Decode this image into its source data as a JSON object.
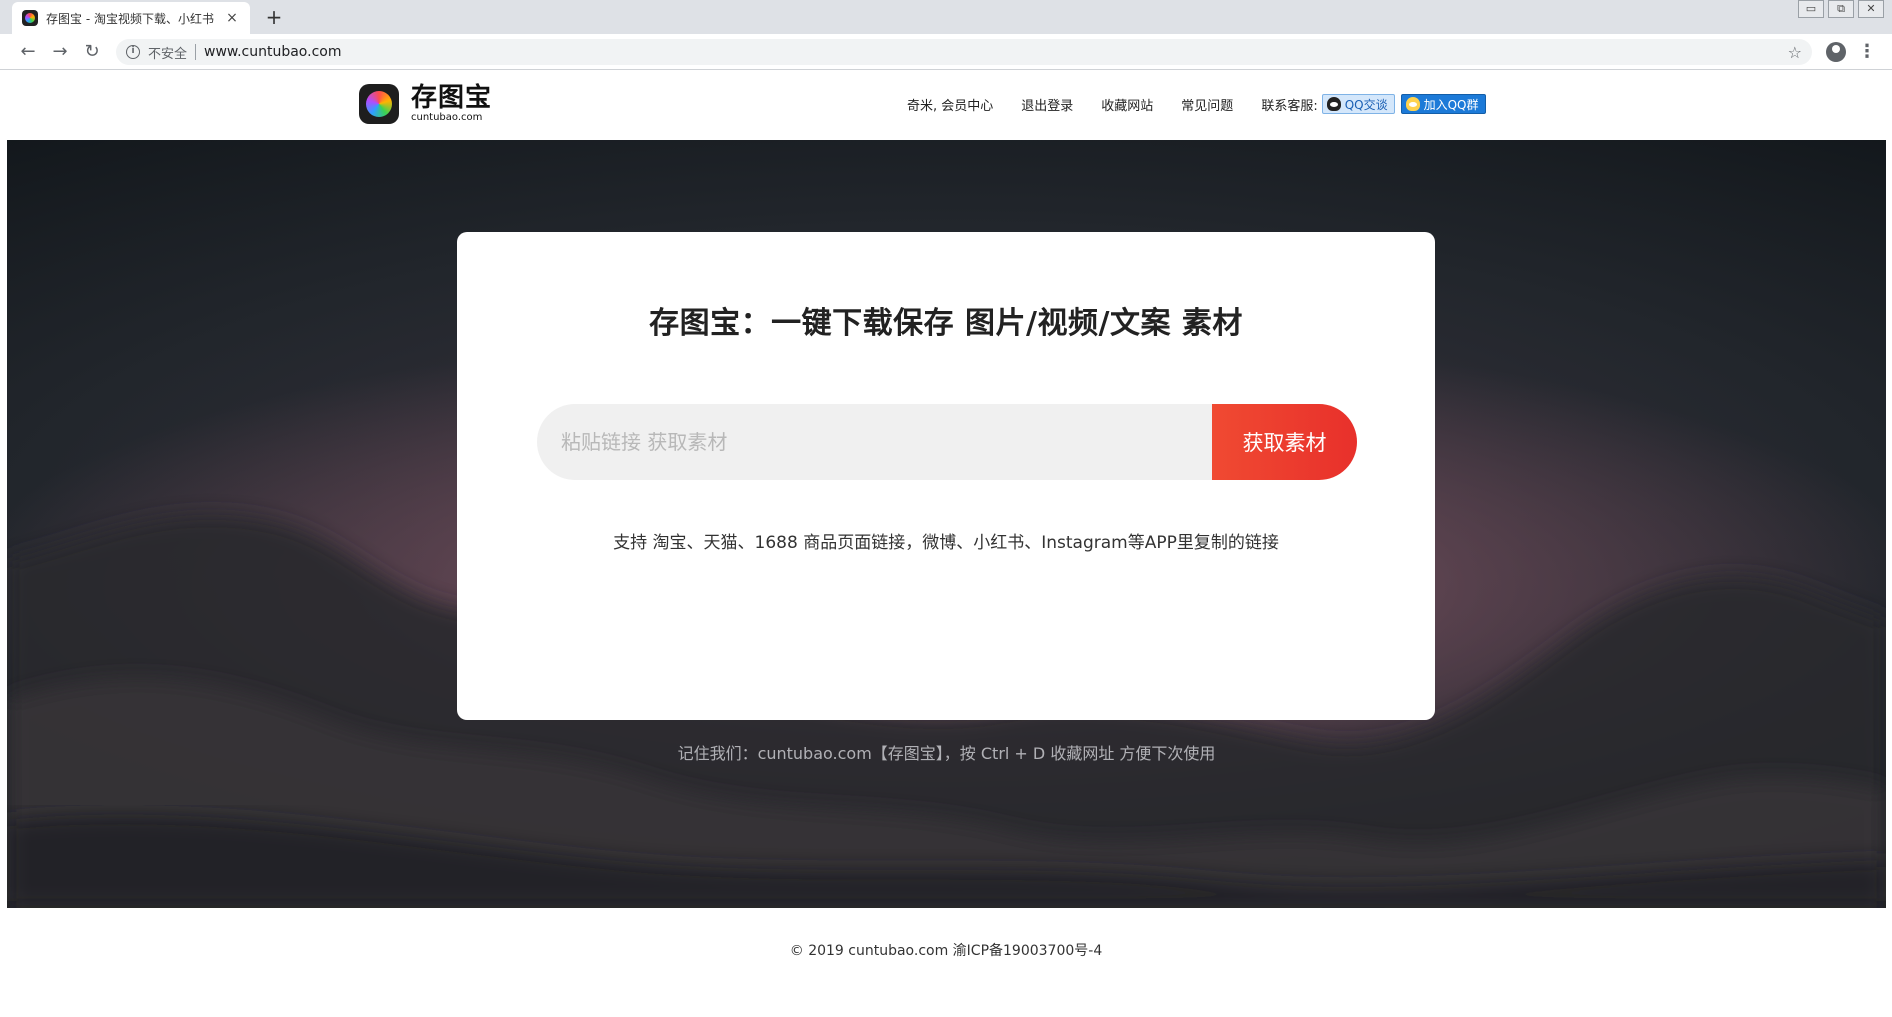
{
  "browser": {
    "tab_title": "存图宝 - 淘宝视频下载、小红书",
    "tab_close": "×",
    "new_tab": "+",
    "insecure_label": "不安全",
    "url": "www.cuntubao.com",
    "win_minimize": "▭",
    "win_restore": "⧉",
    "win_close": "✕",
    "icons": [
      "back-icon",
      "forward-icon",
      "reload-icon",
      "info-icon",
      "star-icon",
      "profile-icon",
      "menu-icon"
    ]
  },
  "header": {
    "logo_name": "存图宝",
    "logo_domain": "cuntubao.com",
    "nav": {
      "member": "奇米, 会员中心",
      "logout": "退出登录",
      "bookmark": "收藏网站",
      "faq": "常见问题",
      "contact_label": "联系客服:",
      "qq_chat": "QQ交谈",
      "qq_group": "加入QQ群"
    }
  },
  "hero": {
    "title": "存图宝：一键下载保存 图片/视频/文案 素材",
    "search_placeholder": "粘贴链接 获取素材",
    "search_value": "",
    "search_button": "获取素材",
    "support_text": "支持 淘宝、天猫、1688 商品页面链接，微博、小红书、Instagram等APP里复制的链接",
    "remember_text": "记住我们：cuntubao.com【存图宝】，按 Ctrl + D 收藏网址 方便下次使用"
  },
  "footer": {
    "copyright": "© 2019 cuntubao.com 渝ICP备19003700号-4"
  },
  "colors": {
    "accent_button": "#e8302b",
    "qq_group_bg": "#1c7ad8"
  }
}
